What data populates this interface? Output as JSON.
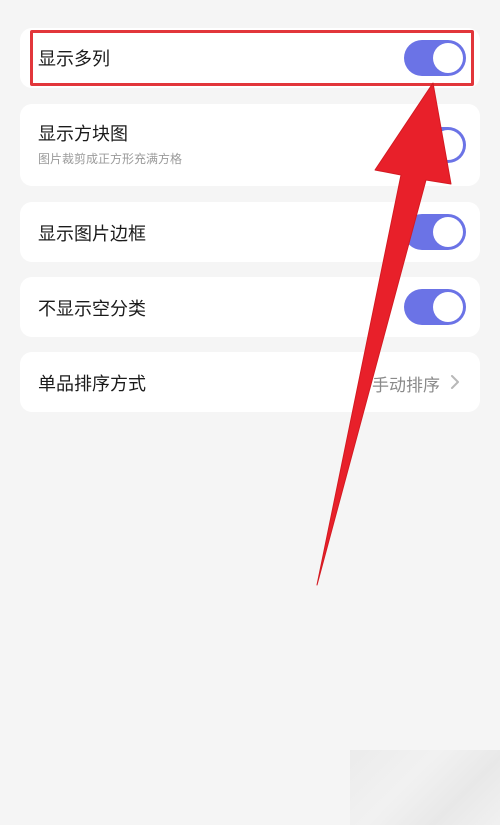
{
  "settings": {
    "show_multi_column": {
      "label": "显示多列",
      "enabled": true
    },
    "show_square_image": {
      "label": "显示方块图",
      "description": "图片裁剪成正方形充满方格",
      "enabled": true
    },
    "show_image_border": {
      "label": "显示图片边框",
      "enabled": true
    },
    "hide_empty_category": {
      "label": "不显示空分类",
      "enabled": true
    },
    "item_sort_method": {
      "label": "单品排序方式",
      "value": "手动排序"
    }
  },
  "colors": {
    "toggle_on": "#6b73e6",
    "highlight_border": "#e2363b",
    "arrow": "#e8202a",
    "background": "#f5f5f5",
    "card": "#ffffff"
  },
  "icons": {
    "chevron": "chevron-right-icon",
    "annotation": "red-arrow-icon"
  }
}
